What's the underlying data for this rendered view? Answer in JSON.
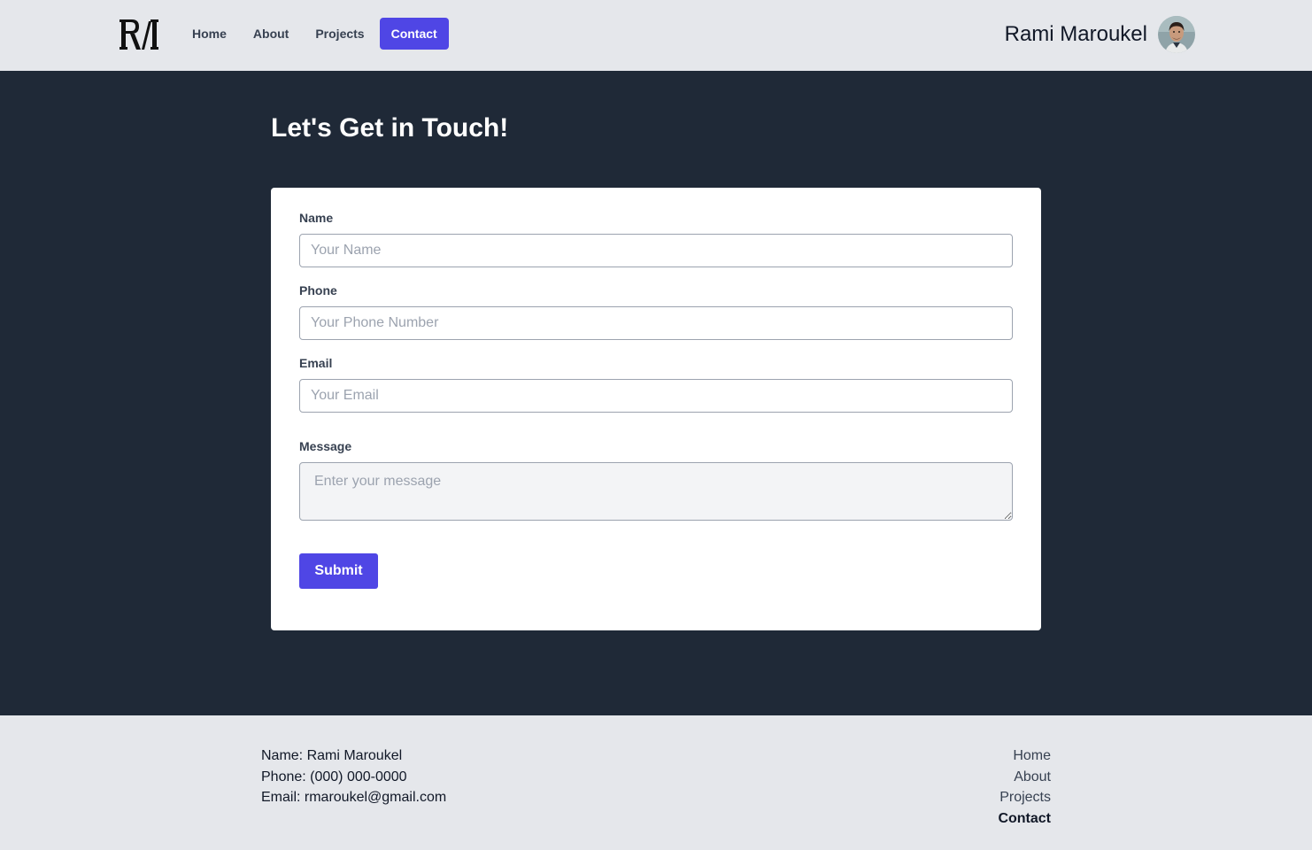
{
  "brand": {
    "logo_icon": "rm-monogram-logo"
  },
  "nav": {
    "items": [
      {
        "label": "Home",
        "active": false
      },
      {
        "label": "About",
        "active": false
      },
      {
        "label": "Projects",
        "active": false
      },
      {
        "label": "Contact",
        "active": true
      }
    ]
  },
  "user": {
    "name": "Rami Maroukel",
    "avatar_icon": "user-avatar"
  },
  "page": {
    "title": "Let's Get in Touch!"
  },
  "form": {
    "name_label": "Name",
    "name_placeholder": "Your Name",
    "phone_label": "Phone",
    "phone_placeholder": "Your Phone Number",
    "email_label": "Email",
    "email_placeholder": "Your Email",
    "message_label": "Message",
    "message_placeholder": "Enter your message",
    "submit_label": "Submit"
  },
  "footer": {
    "name_line": "Name: Rami Maroukel",
    "phone_line": "Phone: (000) 000-0000",
    "email_line": "Email: rmaroukel@gmail.com",
    "links": [
      {
        "label": "Home",
        "active": false
      },
      {
        "label": "About",
        "active": false
      },
      {
        "label": "Projects",
        "active": false
      },
      {
        "label": "Contact",
        "active": true
      }
    ]
  },
  "colors": {
    "accent": "#4f46e5",
    "hero_bg": "#1f2937",
    "bar_bg": "#e5e7eb"
  }
}
